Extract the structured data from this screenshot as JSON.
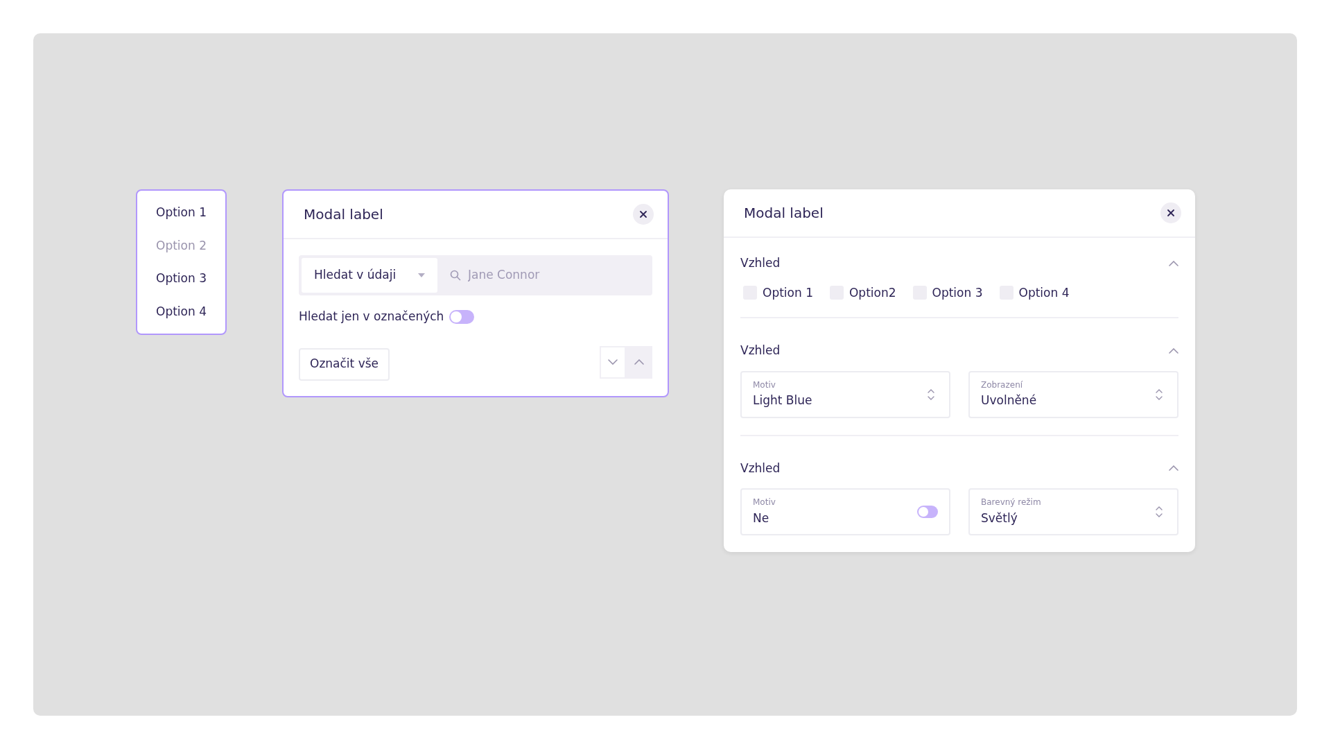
{
  "menu": {
    "items": [
      {
        "label": "Option 1",
        "disabled": false
      },
      {
        "label": "Option 2",
        "disabled": true
      },
      {
        "label": "Option 3",
        "disabled": false
      },
      {
        "label": "Option 4",
        "disabled": false
      }
    ]
  },
  "search_modal": {
    "title": "Modal label",
    "search": {
      "scope": "Hledat v údaji",
      "placeholder": "Jane Connor"
    },
    "filter_toggle": {
      "label": "Hledat jen v označených",
      "on": false
    },
    "select_all_button": "Označit vše"
  },
  "settings_modal": {
    "title": "Modal label",
    "sections": [
      {
        "title": "Vzhled",
        "expanded": true,
        "kind": "checkboxes",
        "options": [
          {
            "label": "Option 1",
            "checked": false
          },
          {
            "label": "Option2",
            "checked": false
          },
          {
            "label": "Option 3",
            "checked": false
          },
          {
            "label": "Option 4",
            "checked": false
          }
        ]
      },
      {
        "title": "Vzhled",
        "expanded": true,
        "kind": "fields",
        "fields": [
          {
            "kind": "select",
            "label": "Motiv",
            "value": "Light Blue"
          },
          {
            "kind": "select",
            "label": "Zobrazení",
            "value": "Uvolněné"
          }
        ]
      },
      {
        "title": "Vzhled",
        "expanded": true,
        "kind": "fields",
        "fields": [
          {
            "kind": "toggle",
            "label": "Motiv",
            "value": "Ne",
            "on": false
          },
          {
            "kind": "select",
            "label": "Barevný režim",
            "value": "Světlý"
          }
        ]
      }
    ]
  }
}
